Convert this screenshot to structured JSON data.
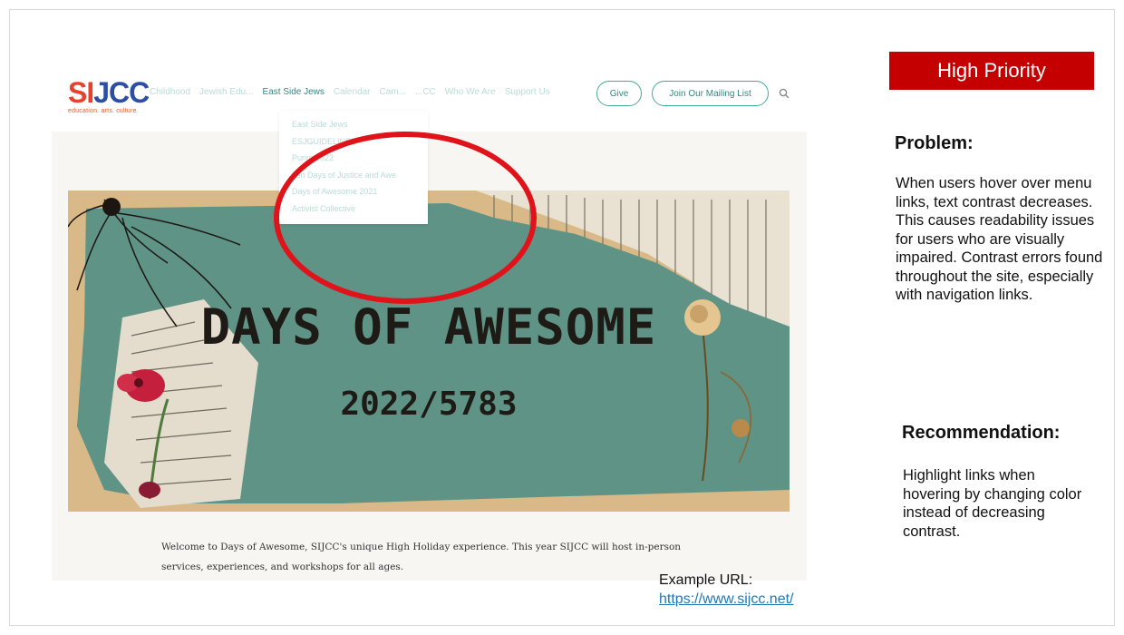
{
  "annotation": {
    "priority": "High Priority",
    "problem_heading": "Problem:",
    "problem_text": "When users hover over menu links, text contrast decreases. This causes readability issues for users who are visually impaired. Contrast errors found throughout the site, especially with navigation links.",
    "recommendation_heading": "Recommendation:",
    "recommendation_text": "Highlight links when hovering by changing color instead of decreasing contrast.",
    "url_label": "Example URL:",
    "url": "https://www.sijcc.net/"
  },
  "site": {
    "logo": {
      "letters": [
        "S",
        "I",
        "J",
        "C",
        "C"
      ],
      "tagline": "education. arts. culture."
    },
    "nav": [
      "Childhood",
      "Jewish Edu...",
      "East Side Jews",
      "Calendar",
      "Cam...",
      "...CC",
      "Who We Are",
      "Support Us"
    ],
    "buttons": {
      "give": "Give",
      "mailing": "Join Our Mailing List"
    },
    "dropdown": [
      "East Side Jews",
      "ESJGUIDELINES",
      "Purim 2022",
      "Ten Days of Justice and Awe",
      "Days of Awesome 2021",
      "Activist Collective"
    ],
    "hero": {
      "title": "DAYS OF AWESOME",
      "year": "2022/5783"
    },
    "welcome_text": "Welcome to Days of Awesome, SIJCC's unique High Holiday experience. This year SIJCC will host in-person services, experiences, and workshops for all ages."
  },
  "colors": {
    "priority": "#c40000",
    "highlight_ring": "#e0131b",
    "nav_faded": "#b9dcd6",
    "nav_active": "#2f8a80",
    "banner_teal": "#5e9386"
  }
}
